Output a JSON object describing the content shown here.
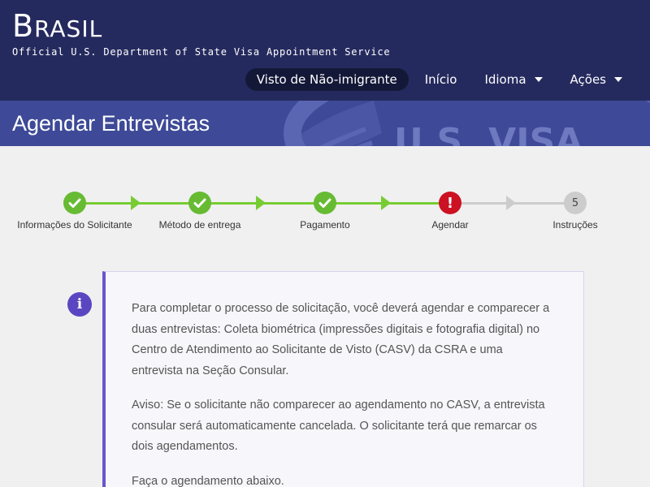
{
  "header": {
    "brand_cap": "B",
    "brand_rest": "RASIL",
    "subtitle": "Official U.S. Department of State Visa Appointment Service",
    "nav": [
      {
        "label": "Visto de Não-imigrante",
        "active": true,
        "dropdown": false
      },
      {
        "label": "Início",
        "active": false,
        "dropdown": false
      },
      {
        "label": "Idioma",
        "active": false,
        "dropdown": true
      },
      {
        "label": "Ações",
        "active": false,
        "dropdown": true
      }
    ]
  },
  "banner": {
    "title": "Agendar Entrevistas",
    "seal_text": "U.S. VISA"
  },
  "stepper": {
    "steps": [
      {
        "label": "Informações do Solicitante",
        "status": "done",
        "icon": "check-icon"
      },
      {
        "label": "Método de entrega",
        "status": "done",
        "icon": "check-icon"
      },
      {
        "label": "Pagamento",
        "status": "done",
        "icon": "check-icon"
      },
      {
        "label": "Agendar",
        "status": "current",
        "icon": "exclamation-icon",
        "glyph": "!"
      },
      {
        "label": "Instruções",
        "status": "todo",
        "number": "5"
      }
    ]
  },
  "info": {
    "icon": "i",
    "paragraphs": [
      "Para completar o processo de solicitação, você deverá agendar e comparecer a duas entrevistas: Coleta biométrica (impressões digitais e fotografia digital) no Centro de Atendimento ao Solicitante de Visto (CASV) da CSRA e uma entrevista na Seção Consular.",
      "Aviso: Se o solicitante não comparecer ao agendamento no CASV, a entrevista consular será automaticamente cancelada. O solicitante terá que remarcar os dois agendamentos.",
      "Faça o agendamento abaixo."
    ]
  },
  "colors": {
    "header_bg": "#252a5e",
    "banner_bg": "#3e4a97",
    "done_green": "#66bb33",
    "alert_red": "#cc1122",
    "info_purple": "#5b46c2"
  }
}
